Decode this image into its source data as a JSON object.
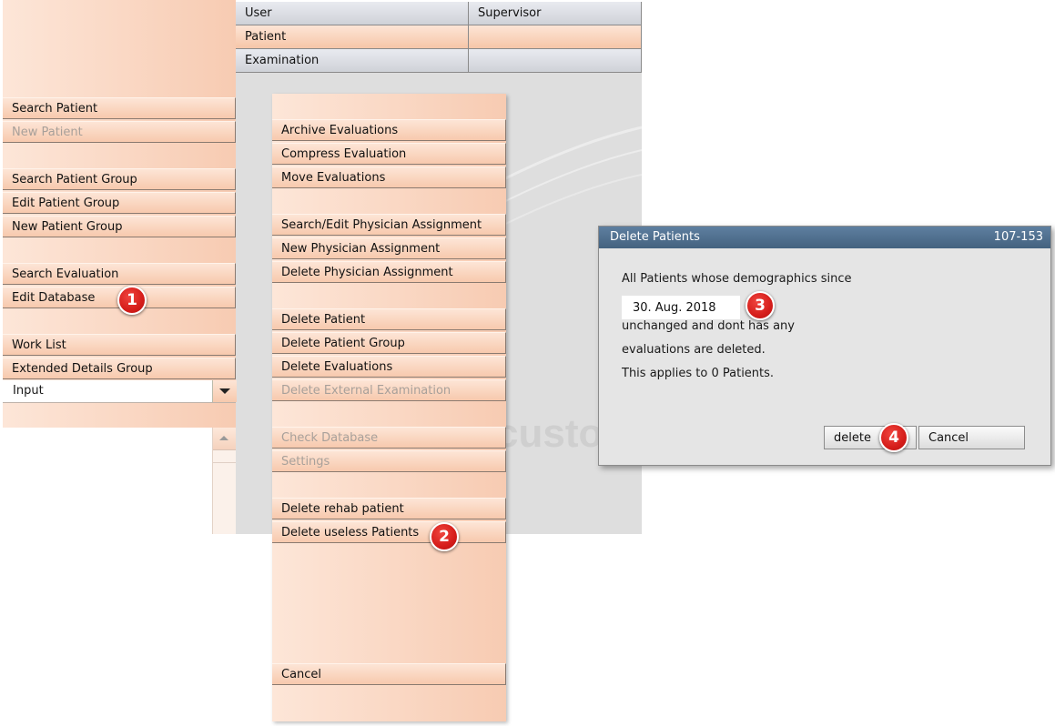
{
  "header": {
    "rows": [
      {
        "label": "User",
        "value": "Supervisor"
      },
      {
        "label": "Patient",
        "value": ""
      },
      {
        "label": "Examination",
        "value": ""
      }
    ]
  },
  "left_menu": {
    "search_patient": "Search Patient",
    "new_patient": "New Patient",
    "search_patient_group": "Search Patient Group",
    "edit_patient_group": "Edit Patient Group",
    "new_patient_group": "New Patient Group",
    "search_evaluation": "Search Evaluation",
    "edit_database": "Edit Database",
    "work_list": "Work List",
    "extended_details_group": "Extended Details Group",
    "input_select_value": "Input"
  },
  "db_menu": {
    "archive_evaluations": "Archive Evaluations",
    "compress_evaluation": "Compress Evaluation",
    "move_evaluations": "Move Evaluations",
    "search_edit_physician": "Search/Edit Physician Assignment",
    "new_physician": "New Physician Assignment",
    "delete_physician": "Delete Physician Assignment",
    "delete_patient": "Delete Patient",
    "delete_patient_group": "Delete Patient Group",
    "delete_evaluations": "Delete Evaluations",
    "delete_external_examination": "Delete External Examination",
    "check_database": "Check Database",
    "settings": "Settings",
    "delete_rehab_patient": "Delete rehab patient",
    "delete_useless_patients": "Delete useless Patients",
    "cancel": "Cancel"
  },
  "watermark": "custo",
  "dialog": {
    "title": "Delete Patients",
    "code": "107-153",
    "line1": "All Patients whose demographics since",
    "date_value": "30. Aug. 2018",
    "line2": "unchanged and dont has any",
    "line3": "evaluations are deleted.",
    "line4": "This applies to 0 Patients.",
    "delete_label": "delete",
    "cancel_label": "Cancel"
  },
  "badges": {
    "b1": "1",
    "b2": "2",
    "b3": "3",
    "b4": "4"
  },
  "colors": {
    "dialog_title_bar": "#4f6f8f",
    "badge_red": "#d51d1a",
    "menu_peach": "#f7c9ad"
  }
}
